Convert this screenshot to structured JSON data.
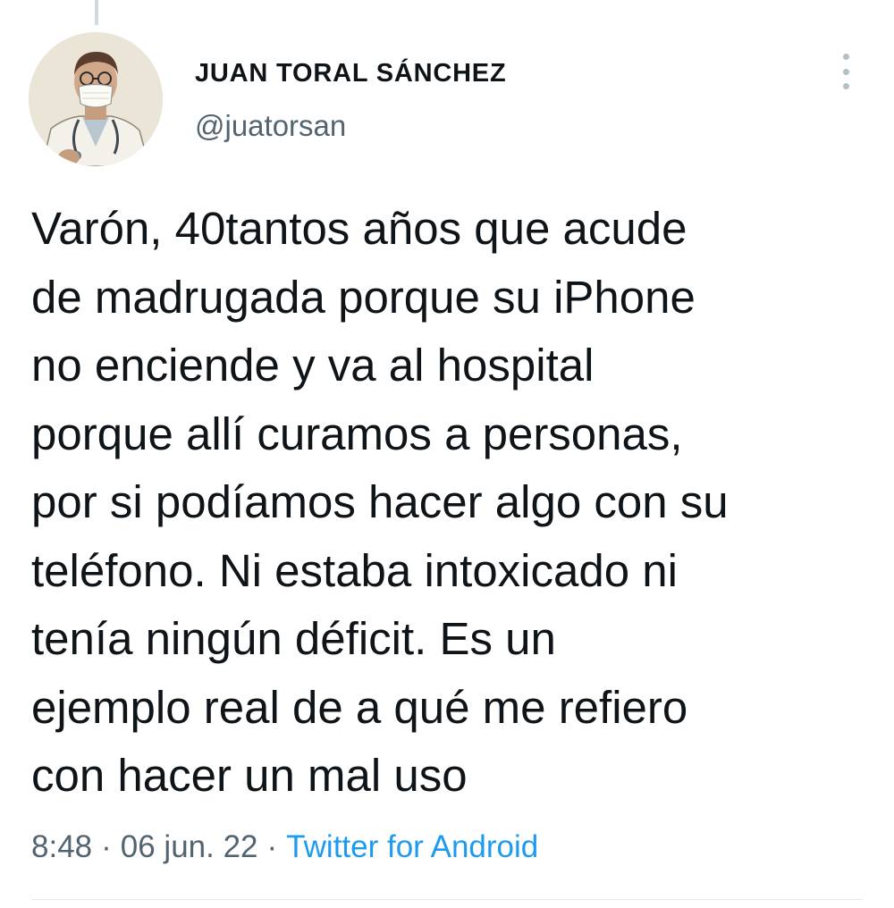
{
  "tweet": {
    "author": {
      "display_name": "JUAN TORAL SÁNCHEZ",
      "handle": "@juatorsan",
      "avatar_icon": "doctor-with-mask-avatar"
    },
    "text": "Varón, 40tantos años que acude\nde madrugada porque su iPhone\nno enciende y va al hospital\nporque allí curamos a personas,\npor si podíamos hacer algo con su\nteléfono. Ni estaba intoxicado ni\ntenía ningún déficit. Es un\nejemplo real de a qué me refiero\ncon hacer un mal uso",
    "time": "8:48",
    "separator": "·",
    "date": "06 jun. 22",
    "source": "Twitter for Android",
    "more_icon": "vertical-ellipsis-icon"
  },
  "colors": {
    "text": "#0f1419",
    "secondary": "#536471",
    "link": "#1d9bf0",
    "divider": "#e4e9ec"
  }
}
